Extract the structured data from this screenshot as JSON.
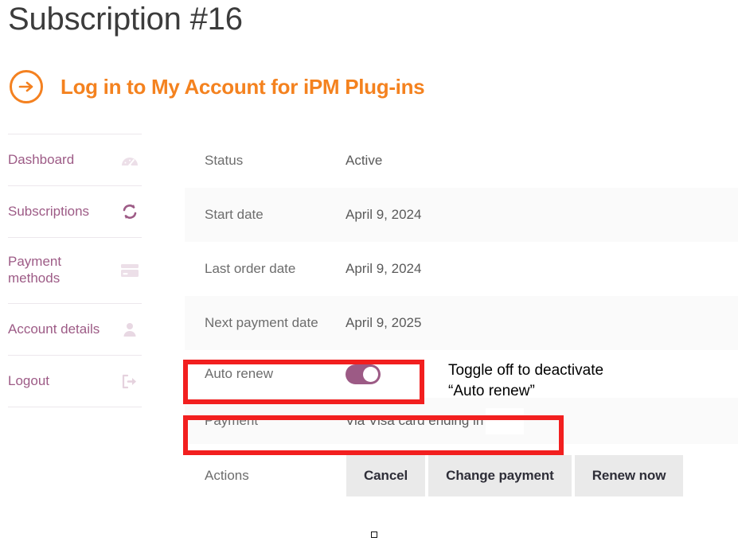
{
  "page": {
    "title": "Subscription #16"
  },
  "banner": {
    "icon": "arrow-right-circle-icon",
    "text": "Log in to My Account for iPM Plug-ins",
    "accent_color": "#f4821f"
  },
  "sidebar": {
    "accent_color": "#9d5b86",
    "items": [
      {
        "label": "Dashboard",
        "icon": "gauge-icon"
      },
      {
        "label": "Subscriptions",
        "icon": "sync-refresh-icon"
      },
      {
        "label": "Payment methods",
        "icon": "credit-card-icon"
      },
      {
        "label": "Account details",
        "icon": "user-icon"
      },
      {
        "label": "Logout",
        "icon": "logout-icon"
      }
    ]
  },
  "details": {
    "rows": [
      {
        "label": "Status",
        "value": "Active"
      },
      {
        "label": "Start date",
        "value": "April 9, 2024"
      },
      {
        "label": "Last order date",
        "value": "April 9, 2024"
      },
      {
        "label": "Next payment date",
        "value": "April 9, 2025"
      },
      {
        "label": "Auto renew",
        "value": ""
      },
      {
        "label": "Payment",
        "value": "Via Visa card ending in"
      },
      {
        "label": "Actions",
        "value": ""
      }
    ],
    "auto_renew": {
      "state": "on",
      "color": "#9c5a85"
    },
    "actions": {
      "buttons": [
        "Cancel",
        "Change payment",
        "Renew now"
      ]
    }
  },
  "annotations": {
    "highlight_color": "#f21f1f",
    "toggle_note": "Toggle off to deactivate\n“Auto renew”"
  }
}
